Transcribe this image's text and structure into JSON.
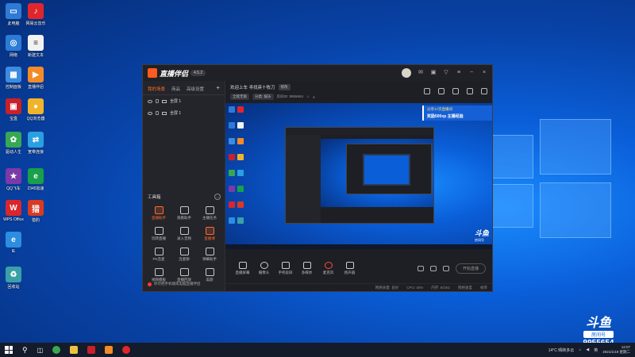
{
  "desktop": {
    "icons": [
      {
        "label": "此电脑",
        "color": "#2d7bd6",
        "glyph": "▭"
      },
      {
        "label": "网易云音乐",
        "color": "#e0262d",
        "glyph": "♪"
      },
      {
        "label": "网络",
        "color": "#2d7bd6",
        "glyph": "◎"
      },
      {
        "label": "新建文本",
        "color": "#f2f2f2",
        "glyph": "≡"
      },
      {
        "label": "控制面板",
        "color": "#3d8be0",
        "glyph": "▦"
      },
      {
        "label": "直播伴侣",
        "color": "#f28c28",
        "glyph": "▶"
      },
      {
        "label": "宝盒",
        "color": "#c9202a",
        "glyph": "▣"
      },
      {
        "label": "QQ浏览器",
        "color": "#f0b42a",
        "glyph": "●"
      },
      {
        "label": "驱动人生",
        "color": "#36a852",
        "glyph": "✿"
      },
      {
        "label": "宽带连接",
        "color": "#2aa0e0",
        "glyph": "⇄"
      },
      {
        "label": "QQ飞车",
        "color": "#7a3aa8",
        "glyph": "★"
      },
      {
        "label": "2345加速",
        "color": "#18a04a",
        "glyph": "e"
      },
      {
        "label": "WPS Office",
        "color": "#d9262d",
        "glyph": "W"
      },
      {
        "label": "猎豹",
        "color": "#d93a24",
        "glyph": "猎"
      },
      {
        "label": "IE",
        "color": "#2d8de0",
        "glyph": "e"
      },
      {
        "label": "回收站",
        "color": "#3aa0a8",
        "glyph": "♻"
      }
    ]
  },
  "app": {
    "brand": "直播伴侣",
    "version": "4.5.2",
    "tabs": [
      "我的场景",
      "商品",
      "高级设置"
    ],
    "active_tab": "我的场景",
    "scenes": [
      "全屏 1",
      "全屏 1"
    ],
    "tools_title": "工具箱",
    "tools": [
      {
        "label": "直播助手",
        "highlight": true
      },
      {
        "label": "观看助手",
        "highlight": false
      },
      {
        "label": "主播任务",
        "highlight": false
      },
      {
        "label": "玩转直播",
        "highlight": false
      },
      {
        "label": "录入音频",
        "highlight": false
      },
      {
        "label": "直播课",
        "highlight": true
      },
      {
        "label": "PK连麦",
        "highlight": false
      },
      {
        "label": "连麦聊",
        "highlight": false
      },
      {
        "label": "弹幕助手",
        "highlight": false
      },
      {
        "label": "视频模板",
        "highlight": false
      },
      {
        "label": "直播回放",
        "highlight": false
      },
      {
        "label": "美颜",
        "highlight": false
      }
    ],
    "notice": "你可把手机端或电脑直播伴侣",
    "room": {
      "welcome": "欢迎上车 寻找英十牧刀",
      "edit_label": "修改",
      "tag1": "全能无敌",
      "tag2": "分类: 娱乐",
      "room_id_label": "房间ID: 9955654",
      "fans_count": "4"
    },
    "banner": {
      "line1": "分享17次直播间",
      "line2": "奖励500xp 主播经验"
    },
    "controls": [
      "直播屏幕",
      "摄像头",
      "手机投屏",
      "多媒体",
      "麦克风",
      "扬声器"
    ],
    "start_label": "开始直播",
    "status": [
      "网络质量: 良好",
      "CPU: 40%",
      "内存: 8/16G",
      "网络速度",
      "帧率"
    ]
  },
  "watermark": {
    "logo": "斗鱼",
    "tag": "房间号",
    "room": "9955654"
  },
  "taskbar": {
    "weather": "14°C 晴转多云",
    "time": "12:07",
    "date": "2021/1/19 星期二"
  }
}
